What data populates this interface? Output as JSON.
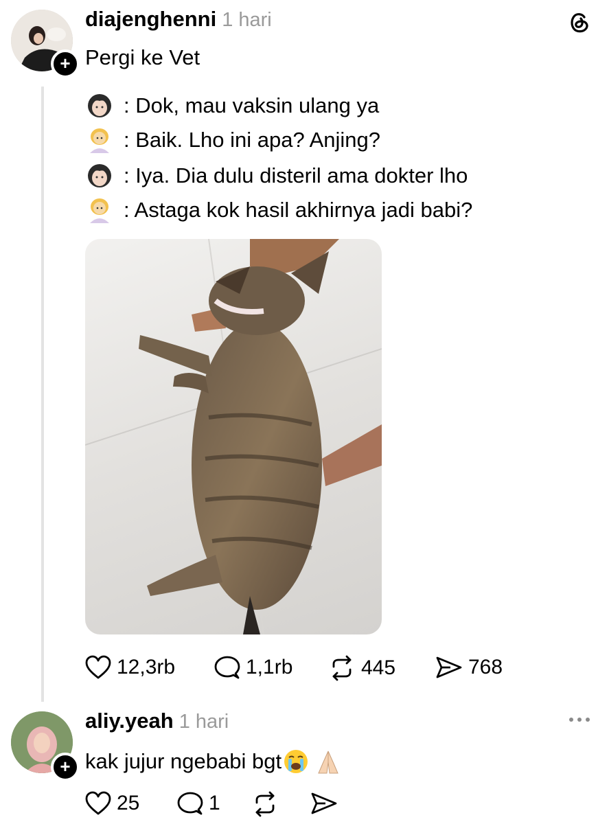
{
  "post": {
    "username": "diajenghenni",
    "time": "1 hari",
    "title": "Pergi ke Vet",
    "dialogue": [
      {
        "speaker": "woman",
        "text": ": Dok, mau vaksin ulang ya"
      },
      {
        "speaker": "health-worker",
        "text": ": Baik. Lho ini apa? Anjing?"
      },
      {
        "speaker": "woman",
        "text": ": Iya. Dia dulu disteril ama dokter lho"
      },
      {
        "speaker": "health-worker",
        "text": ": Astaga kok hasil akhirnya jadi babi?"
      }
    ],
    "stats": {
      "likes": "12,3rb",
      "comments": "1,1rb",
      "reposts": "445",
      "shares": "768"
    }
  },
  "reply": {
    "username": "aliy.yeah",
    "time": "1 hari",
    "text": "kak jujur ngebabi bgt",
    "stats": {
      "likes": "25",
      "comments": "1"
    }
  },
  "icons": {
    "app": "threads-icon",
    "more": "more-icon",
    "follow": "plus-icon"
  }
}
